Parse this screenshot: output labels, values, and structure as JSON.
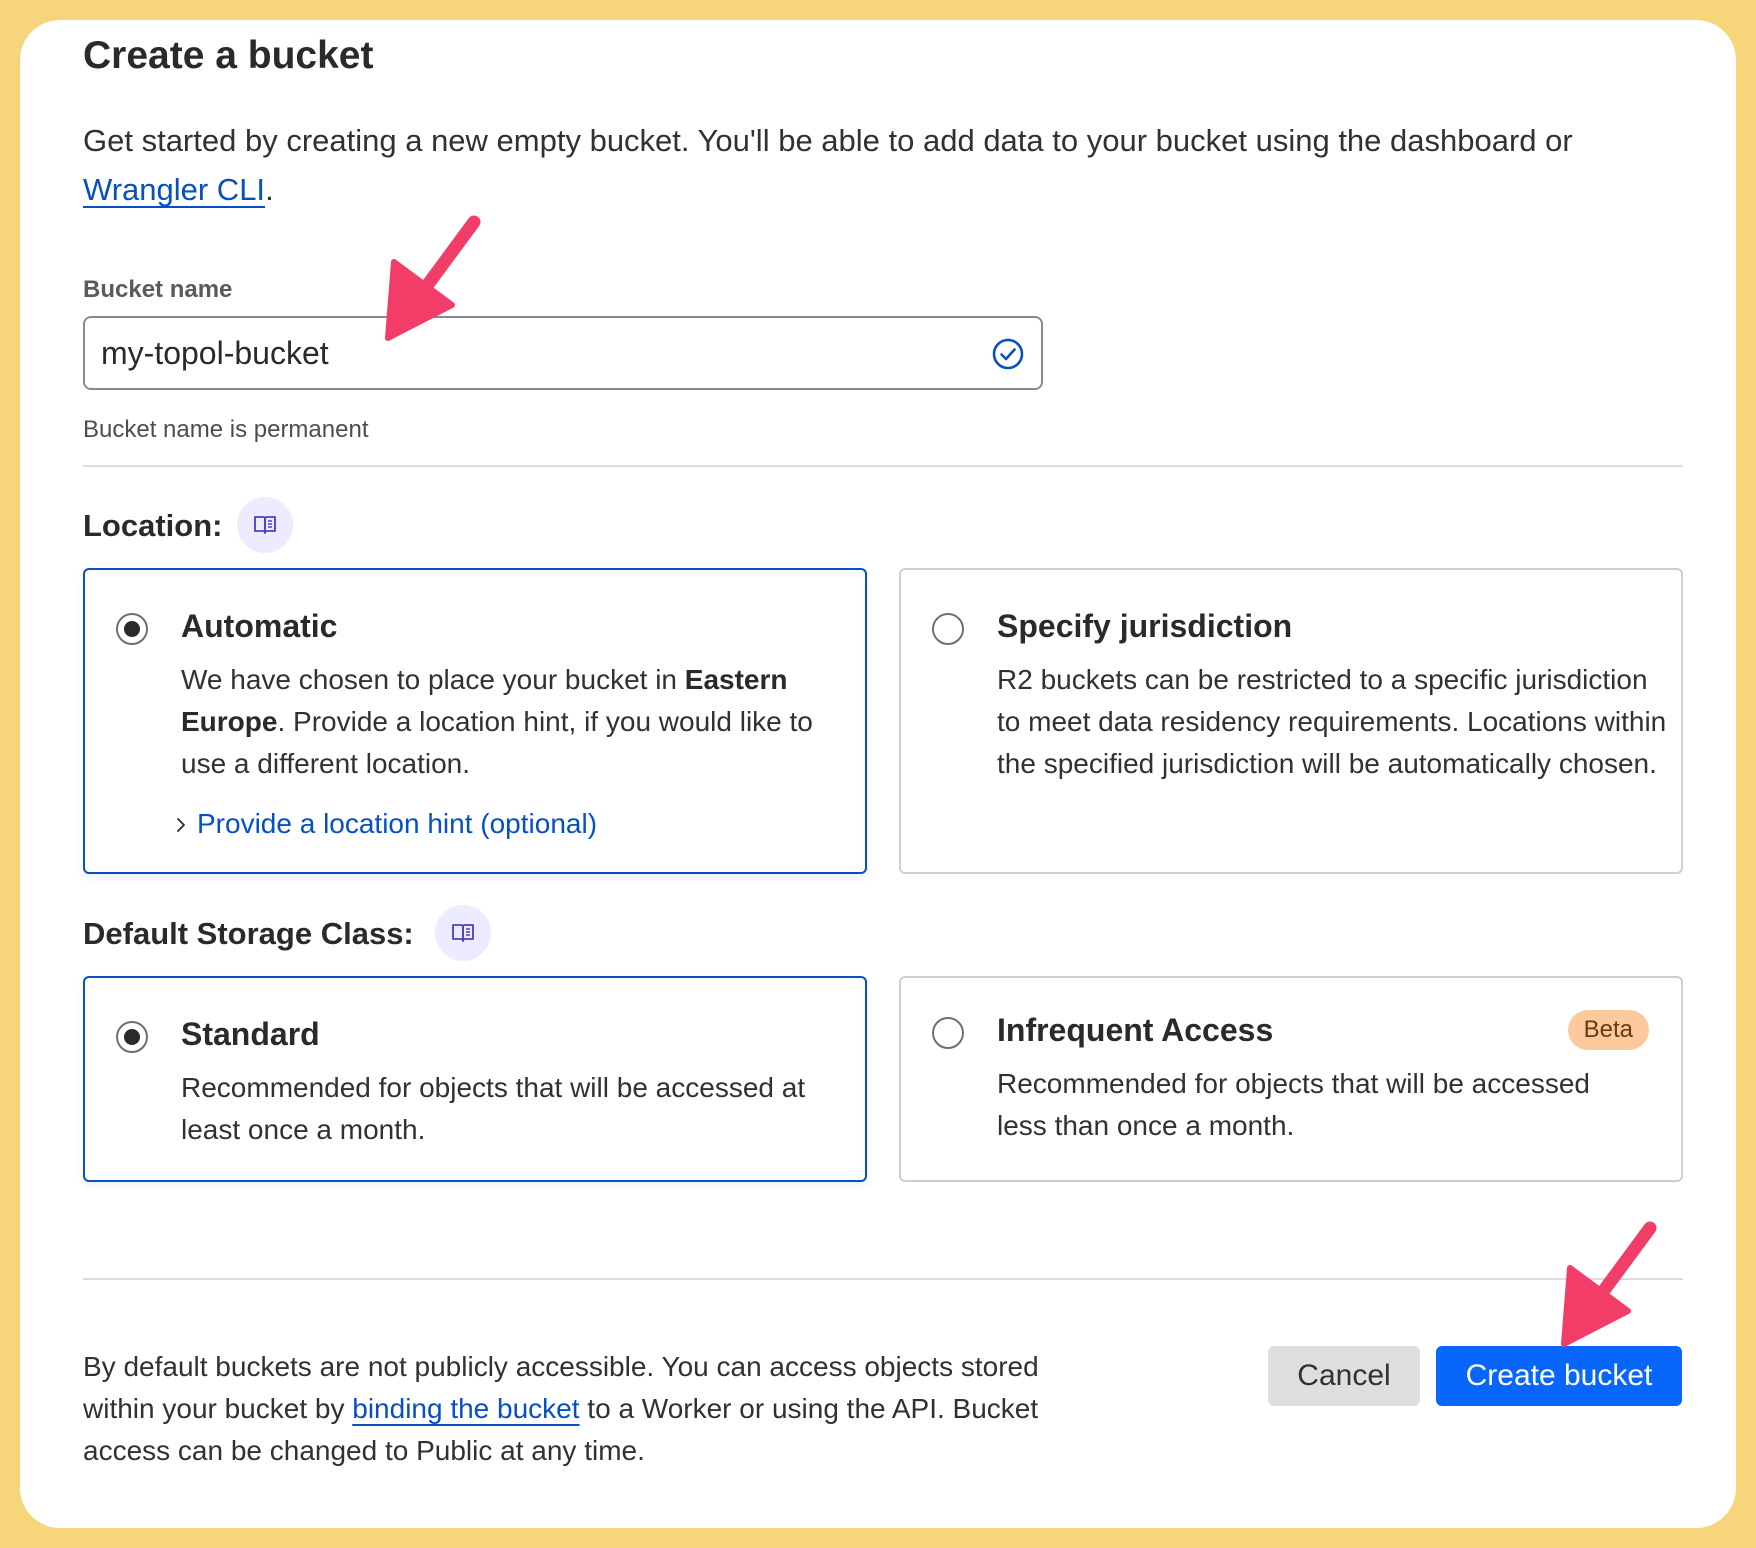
{
  "page": {
    "title": "Create a bucket",
    "intro_text": "Get started by creating a new empty bucket. You'll be able to add data to your bucket using the dashboard or ",
    "intro_link": "Wrangler CLI",
    "intro_end": "."
  },
  "bucket_name": {
    "label": "Bucket name",
    "value": "my-topol-bucket",
    "helper": "Bucket name is permanent",
    "status_icon": "check-circle-icon"
  },
  "location": {
    "label": "Location:",
    "doc_icon": "book-icon",
    "options": [
      {
        "title": "Automatic",
        "selected": true,
        "desc_pre": "We have chosen to place your bucket in ",
        "desc_bold": "Eastern Europe",
        "desc_post": ". Provide a location hint, if you would like to use a different location.",
        "hint_link": "Provide a location hint (optional)"
      },
      {
        "title": "Specify jurisdiction",
        "selected": false,
        "desc": "R2 buckets can be restricted to a specific jurisdiction to meet data residency requirements. Locations within the specified jurisdiction will be automatically chosen."
      }
    ]
  },
  "storage_class": {
    "label": "Default Storage Class:",
    "doc_icon": "book-icon",
    "options": [
      {
        "title": "Standard",
        "selected": true,
        "desc": "Recommended for objects that will be accessed at least once a month."
      },
      {
        "title": "Infrequent Access",
        "selected": false,
        "badge": "Beta",
        "desc": "Recommended for objects that will be accessed less than once a month."
      }
    ]
  },
  "footer": {
    "note_pre": "By default buckets are not publicly accessible. You can access objects stored within your bucket by ",
    "note_link": "binding the bucket",
    "note_post": " to a Worker or using the API. Bucket access can be changed to Public at any time.",
    "cancel_label": "Cancel",
    "create_label": "Create bucket"
  },
  "colors": {
    "background": "#f7d57a",
    "accent": "#0966fc",
    "link": "#0650c4",
    "annotation_arrow": "#f23d68",
    "badge": "#fbc99c"
  }
}
